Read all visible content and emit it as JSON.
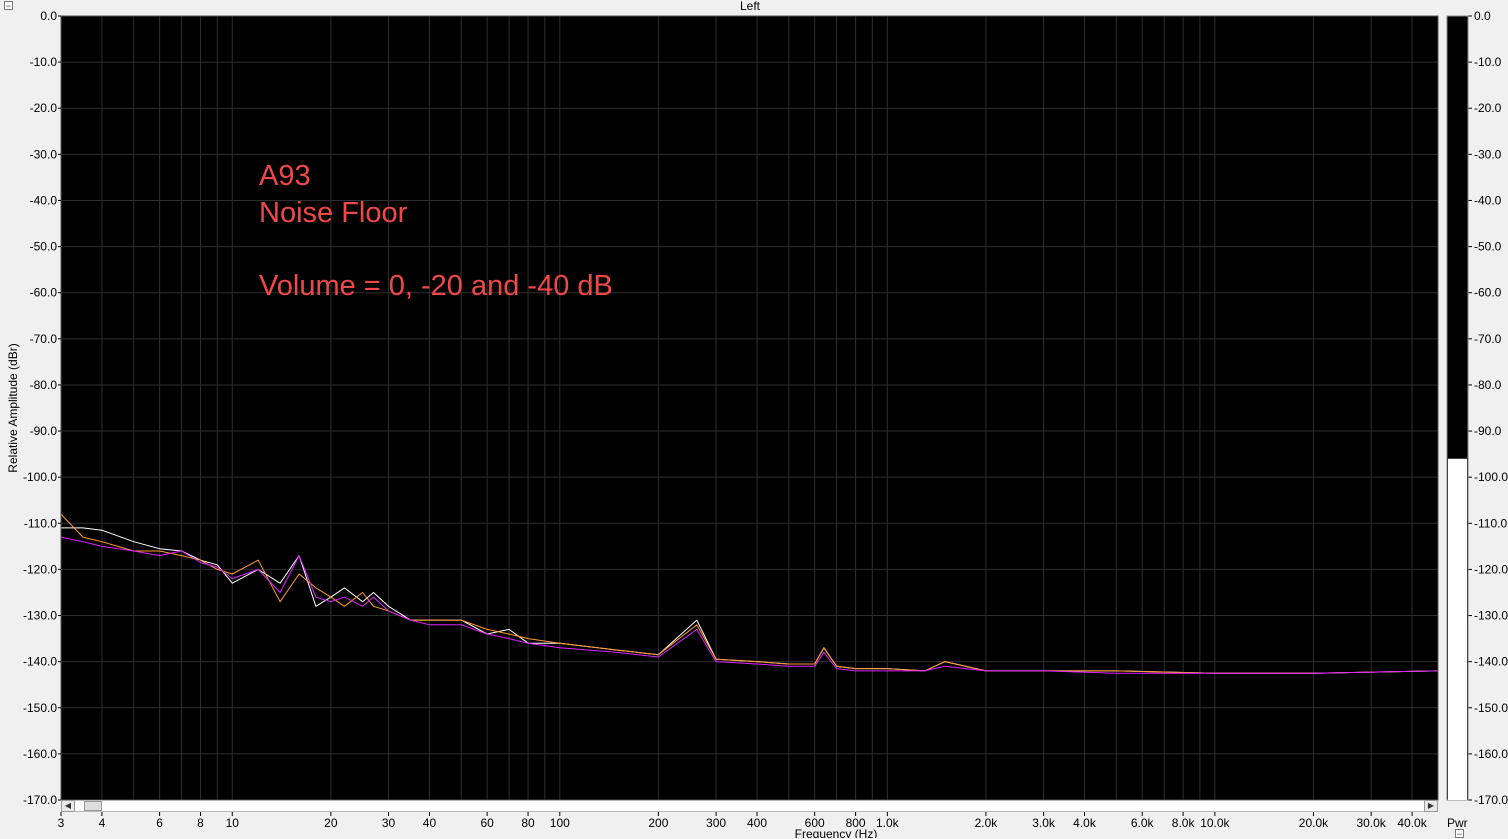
{
  "window": {
    "channel_title": "Left",
    "collapse_glyph": "−"
  },
  "annotation": {
    "line1": "A93",
    "line2": "Noise Floor",
    "line3": "Volume = 0, -20 and -40 dB"
  },
  "meter": {
    "label": "Pwr",
    "level_db": -96,
    "fill_color": "#ffffff"
  },
  "colors": {
    "plot_bg": "#000000",
    "grid": "#2e2e2e",
    "annotation": "#f04848"
  },
  "chart_data": {
    "type": "line",
    "xlabel": "Frequency (Hz)",
    "ylabel": "Relative Amplitude (dBr)",
    "x_scale": "log",
    "xlim": [
      3,
      48000
    ],
    "ylim": [
      -170,
      0
    ],
    "grid": true,
    "y_ticks": [
      0,
      -10,
      -20,
      -30,
      -40,
      -50,
      -60,
      -70,
      -80,
      -90,
      -100,
      -110,
      -120,
      -130,
      -140,
      -150,
      -160,
      -170
    ],
    "y_tick_labels": [
      "0.0",
      "-10.0",
      "-20.0",
      "-30.0",
      "-40.0",
      "-50.0",
      "-60.0",
      "-70.0",
      "-80.0",
      "-90.0",
      "-100.0",
      "-110.0",
      "-120.0",
      "-130.0",
      "-140.0",
      "-150.0",
      "-160.0",
      "-170.0"
    ],
    "x_ticks": [
      3,
      4,
      6,
      8,
      10,
      20,
      30,
      40,
      60,
      80,
      100,
      200,
      300,
      400,
      600,
      800,
      1000,
      2000,
      3000,
      4000,
      6000,
      8000,
      10000,
      20000,
      30000,
      40000
    ],
    "x_tick_labels": [
      "3",
      "4",
      "6",
      "8",
      "10",
      "20",
      "30",
      "40",
      "60",
      "80",
      "100",
      "200",
      "300",
      "400",
      "600",
      "800",
      "1.0k",
      "2.0k",
      "3.0k",
      "4.0k",
      "6.0k",
      "8.0k",
      "10.0k",
      "20.0k",
      "30.0k",
      "40.0k"
    ],
    "series": [
      {
        "color": "#ffffff",
        "x": [
          3,
          3.5,
          4,
          5,
          6,
          7,
          8,
          9,
          10,
          12,
          14,
          16,
          18,
          20,
          22,
          25,
          27,
          30,
          35,
          40,
          50,
          60,
          70,
          80,
          100,
          150,
          200,
          262,
          300,
          400,
          500,
          600,
          640,
          700,
          800,
          1000,
          1300,
          1500,
          2000,
          2800,
          3000,
          5000,
          10000,
          20000,
          48000
        ],
        "y": [
          -111,
          -111,
          -111.5,
          -114,
          -115.5,
          -116,
          -118,
          -119,
          -123,
          -120,
          -123,
          -117,
          -128,
          -126,
          -124,
          -127,
          -125,
          -128,
          -131,
          -131,
          -131,
          -134,
          -133,
          -136,
          -136,
          -137.5,
          -138.5,
          -131,
          -139.5,
          -140,
          -140.5,
          -140.5,
          -137,
          -141,
          -141.5,
          -141.5,
          -142,
          -140,
          -142,
          -142,
          -142,
          -142,
          -142.5,
          -142.5,
          -142
        ]
      },
      {
        "color": "#ff9a30",
        "x": [
          3,
          3.5,
          4,
          5,
          6,
          7,
          8,
          9,
          10,
          12,
          14,
          16,
          18,
          20,
          22,
          25,
          27,
          30,
          35,
          40,
          50,
          60,
          70,
          80,
          100,
          150,
          200,
          262,
          300,
          400,
          500,
          600,
          640,
          700,
          800,
          1000,
          1300,
          1500,
          2000,
          2800,
          3000,
          5000,
          10000,
          20000,
          48000
        ],
        "y": [
          -108,
          -113,
          -114,
          -116,
          -116,
          -117,
          -118,
          -120,
          -121,
          -118,
          -127,
          -121,
          -124,
          -126,
          -128,
          -125,
          -128,
          -129,
          -131,
          -131,
          -131,
          -133,
          -134,
          -135,
          -136,
          -137.5,
          -138.5,
          -132,
          -139.5,
          -140,
          -140.5,
          -140.5,
          -137,
          -141,
          -141.5,
          -141.5,
          -142,
          -140,
          -142,
          -142,
          -142,
          -142,
          -142.5,
          -142.5,
          -142
        ]
      },
      {
        "color": "#e020ff",
        "x": [
          3,
          3.5,
          4,
          5,
          6,
          7,
          8,
          9,
          10,
          12,
          14,
          16,
          18,
          20,
          22,
          25,
          27,
          30,
          35,
          40,
          50,
          60,
          70,
          80,
          100,
          150,
          200,
          262,
          300,
          400,
          500,
          600,
          640,
          700,
          800,
          1000,
          1300,
          1500,
          2000,
          2800,
          3000,
          5000,
          10000,
          20000,
          48000
        ],
        "y": [
          -113,
          -114,
          -115,
          -116,
          -117,
          -116,
          -118.5,
          -119.5,
          -122,
          -120,
          -125,
          -117,
          -126,
          -127,
          -126,
          -128,
          -126,
          -129,
          -131,
          -132,
          -132,
          -134,
          -135,
          -136,
          -137,
          -138,
          -139,
          -133,
          -140,
          -140.5,
          -141,
          -141,
          -138,
          -141.5,
          -142,
          -142,
          -142,
          -141,
          -142,
          -142,
          -142,
          -142.5,
          -142.5,
          -142.5,
          -142
        ]
      }
    ]
  }
}
